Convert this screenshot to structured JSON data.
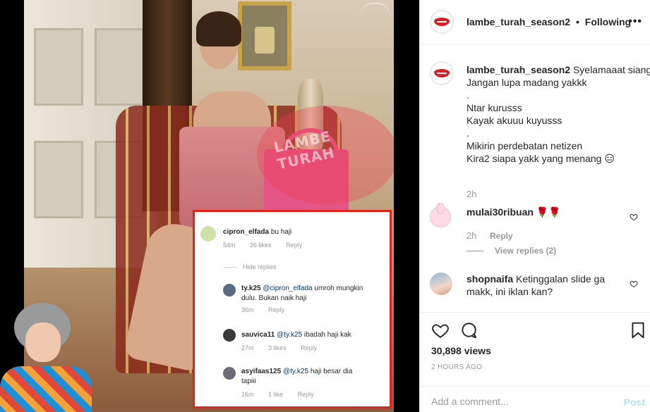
{
  "post": {
    "username": "lambe_turah_season2",
    "separator": "•",
    "follow_status": "Following",
    "more_icon": "more-options-icon"
  },
  "media": {
    "watermark_text": "LAMBE TURAH",
    "overlay_comments": [
      {
        "user": "cipron_elfada",
        "text": "bu haji",
        "time": "54m",
        "likes": "26 likes",
        "reply": "Reply"
      },
      {
        "hide_label": "Hide replies"
      },
      {
        "user": "ty.k25",
        "mention": "@cipron_elfada",
        "text": "umroh mungkin",
        "text2": "dulu. Bukan naik haji",
        "time": "36m",
        "reply": "Reply"
      },
      {
        "user": "sauvica11",
        "mention": "@ty.k25",
        "text": "ibadah haji kak",
        "time": "27m",
        "likes": "3 likes",
        "reply": "Reply"
      },
      {
        "user": "asyifaas125",
        "mention": "@ty.k25",
        "text": "haji besar dia",
        "text2": "tapiii",
        "time": "16m",
        "likes": "1 like",
        "reply": "Reply"
      }
    ]
  },
  "caption": {
    "username": "lambe_turah_season2",
    "lines": [
      "Syelamaaat sianggg kakak...",
      "Jangan lupa madang yakkk",
      ".",
      "Ntar kurusss",
      "Kayak akuuu kuyusss",
      ".",
      "Mikirin perdebatan netizen",
      "Kira2 siapa yakk yang menang 😑"
    ],
    "time": "2h"
  },
  "comments": [
    {
      "username": "mulai30ribuan",
      "text": "🌹🌹",
      "time": "2h",
      "reply_label": "Reply",
      "view_replies": "View replies (2)"
    },
    {
      "username": "shopnaifa",
      "text": "Ketinggalan slide ga makk, ini iklan kan?"
    }
  ],
  "actions": {
    "like_icon": "heart-icon",
    "comment_icon": "comment-icon",
    "save_icon": "bookmark-icon",
    "views": "30,898 views",
    "posted": "2 HOURS AGO"
  },
  "composer": {
    "placeholder": "Add a comment...",
    "post_label": "Post"
  },
  "colors": {
    "border": "#efefef",
    "muted": "#999999",
    "post_button_disabled": "#b2dffc",
    "overlay_border": "#e0241c",
    "mention": "#003569"
  }
}
